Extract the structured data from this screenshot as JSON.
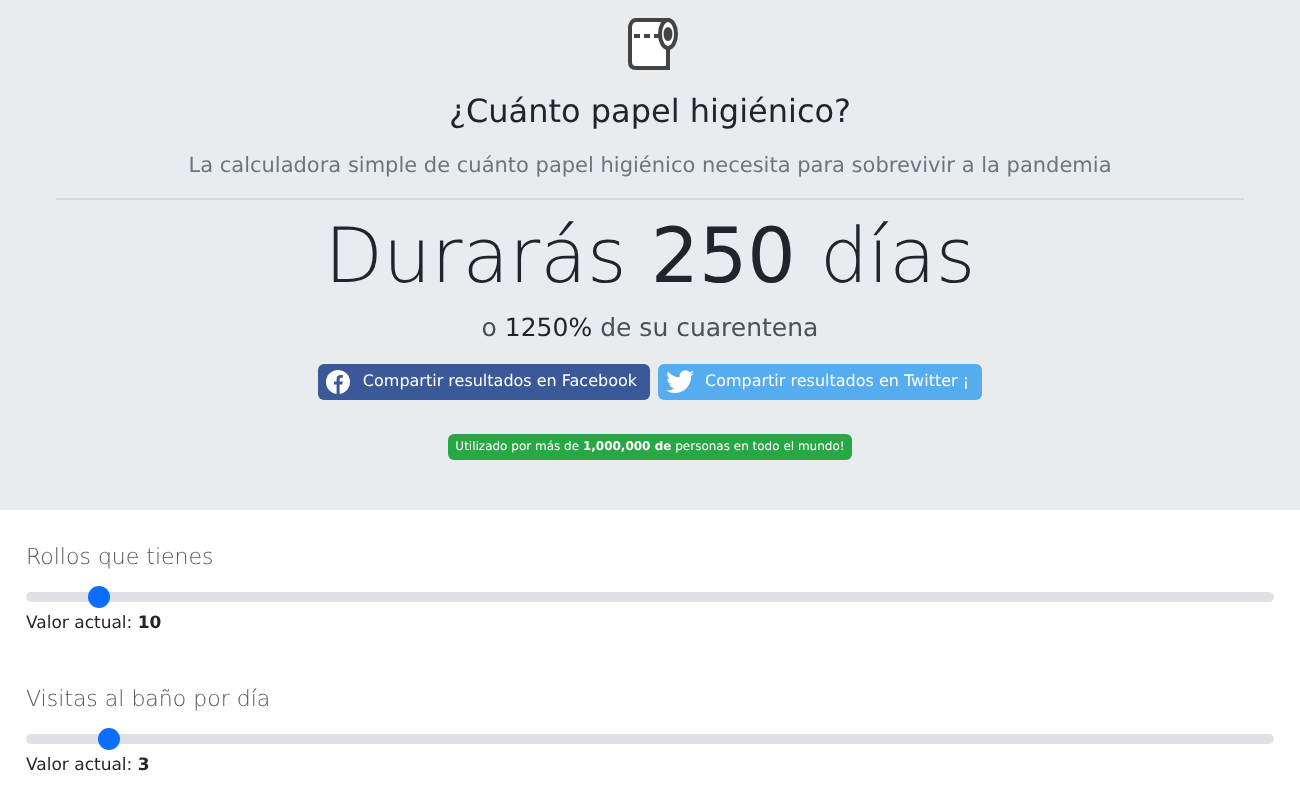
{
  "header": {
    "title": "¿Cuánto papel higiénico?",
    "subtitle": "La calculadora simple de cuánto papel higiénico necesita para sobrevivir a la pandemia",
    "result": "Durarás **250** días",
    "percent": "o **1250%** de su cuarentena",
    "share_buttons": [
      {
        "kind": "facebook",
        "label": "Compartir resultados en Facebook"
      },
      {
        "kind": "twitter",
        "label": "Compartir resultados en Twitter ¡"
      }
    ],
    "badge": "Utilizado por más de **1,000,000 de** personas en todo el mundo!"
  },
  "sliders": [
    {
      "label": "Rollos que tienes",
      "level": 0.05,
      "current": "Valor actual: **10**"
    },
    {
      "label": "Visitas al baño por día",
      "level": 0.058,
      "current": "Valor actual: **3**"
    }
  ]
}
